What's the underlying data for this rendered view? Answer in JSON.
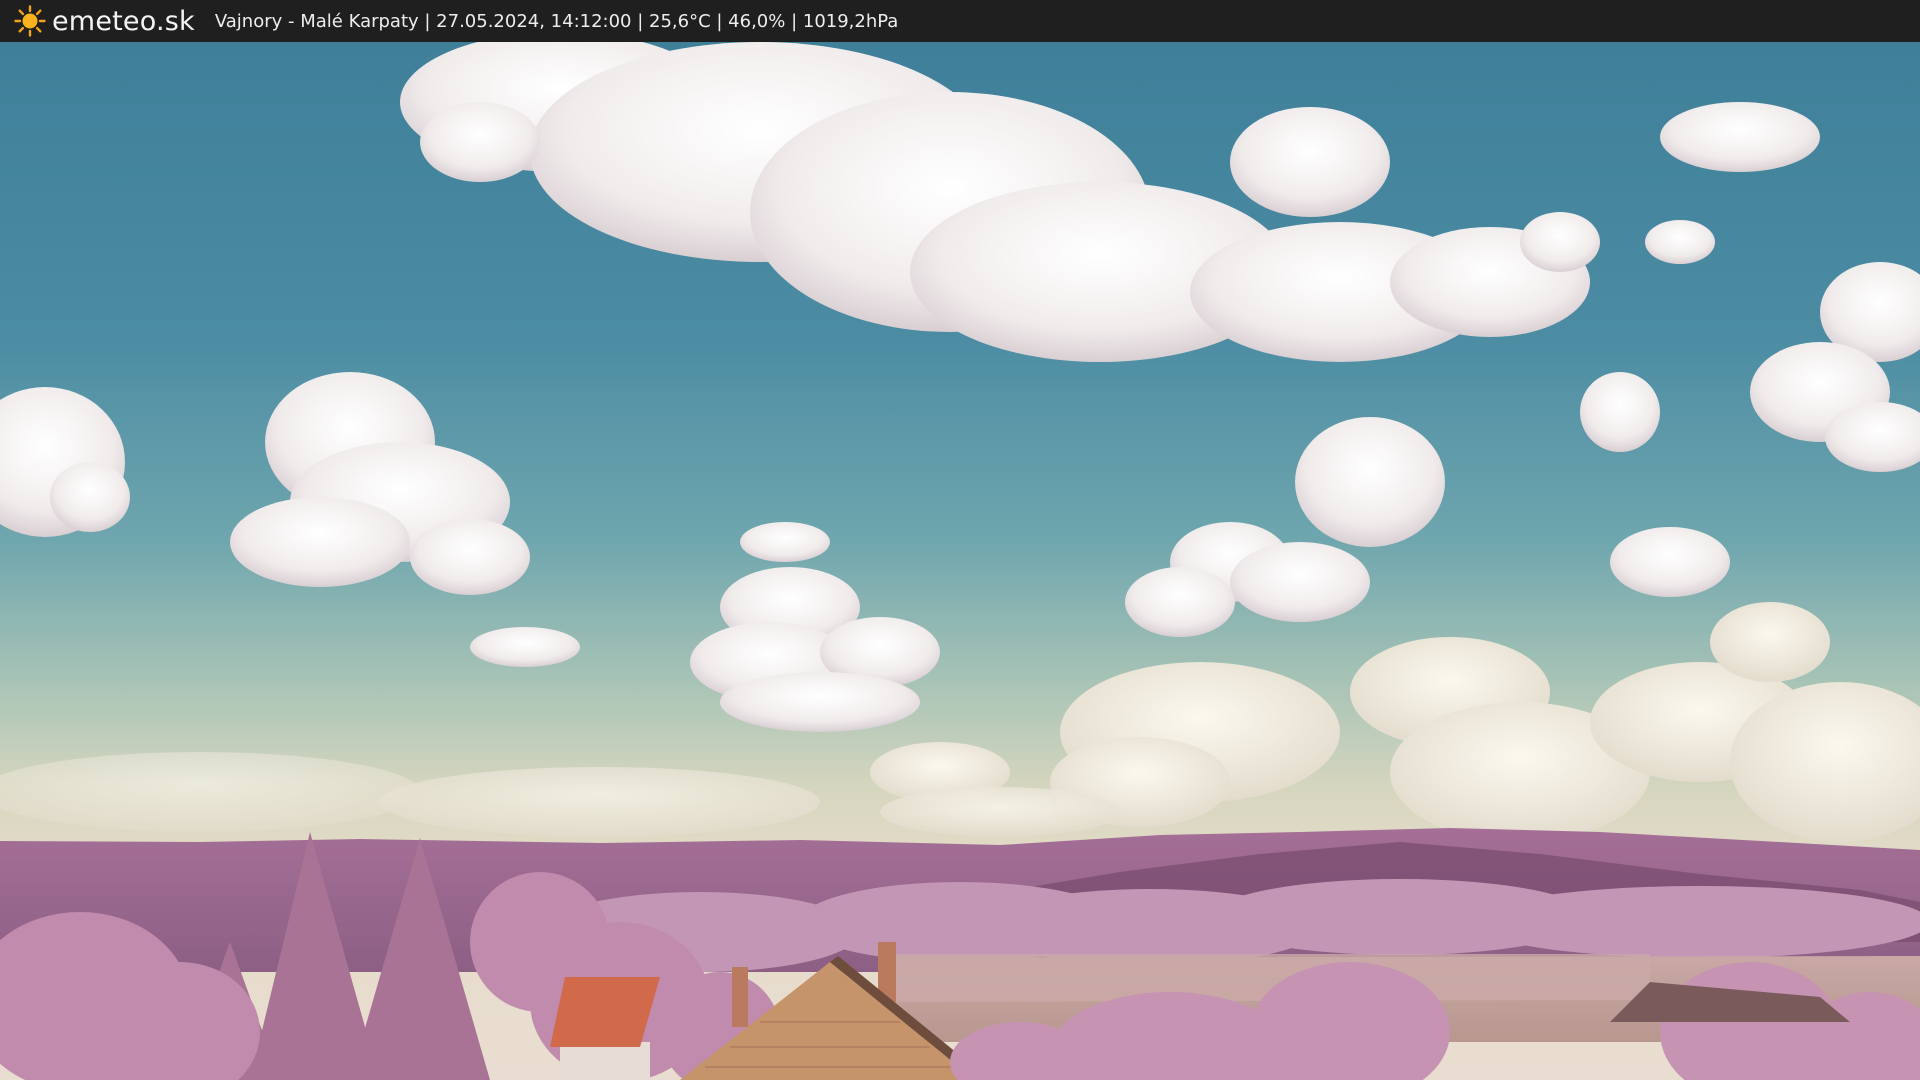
{
  "header": {
    "brand": "emeteo.sk",
    "logo_icon": "sun-icon",
    "caption": "Vajnory - Malé Karpaty | 27.05.2024, 14:12:00 | 25,6°C | 46,0% | 1019,2hPa"
  },
  "colors": {
    "bar_background": "#1f1f1f",
    "sun": "#f5a31a",
    "sky_top": "#3f7f99",
    "foliage": "#b58aa7"
  }
}
